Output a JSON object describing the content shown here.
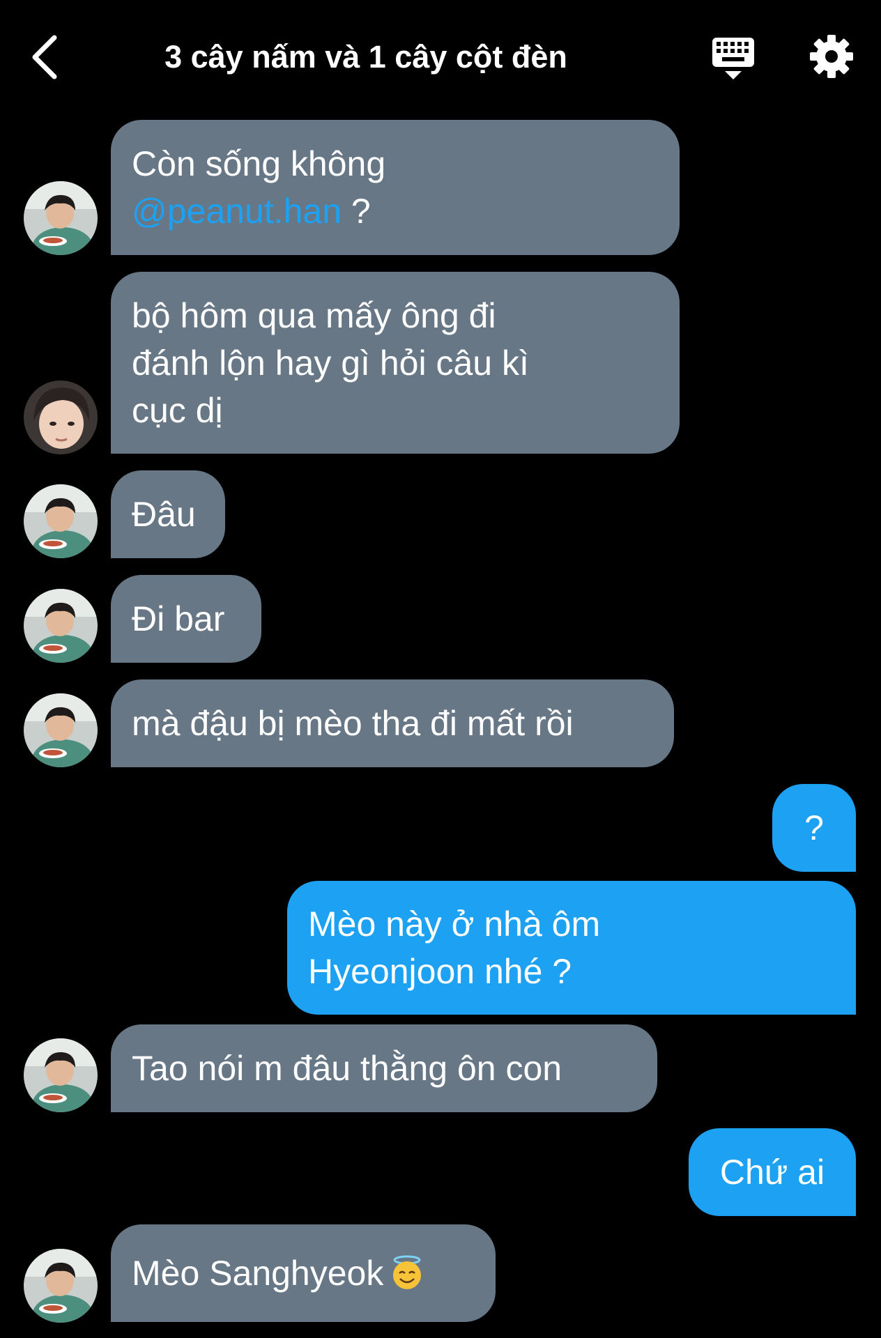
{
  "header": {
    "title": "3 cây nấm và 1 cây cột đèn"
  },
  "messages": [
    {
      "side": "in",
      "avatar": "person-eating",
      "lines": [
        "Còn sống không"
      ],
      "mention": "@peanut.han",
      "mention_suffix": " ?"
    },
    {
      "side": "in",
      "avatar": "person-selfie",
      "lines": [
        "bộ hôm qua mấy ông  đi",
        "đánh lộn hay gì hỏi câu kì",
        "cục dị"
      ]
    },
    {
      "side": "in",
      "avatar": "person-eating",
      "lines": [
        "Đâu"
      ]
    },
    {
      "side": "in",
      "avatar": "person-eating",
      "lines": [
        "Đi bar"
      ]
    },
    {
      "side": "in",
      "avatar": "person-eating",
      "lines": [
        "mà đậu bị mèo tha đi mất rồi"
      ]
    },
    {
      "side": "out",
      "lines": [
        "?"
      ]
    },
    {
      "side": "out",
      "lines": [
        "Mèo này ở nhà ôm",
        "Hyeonjoon nhé ?"
      ]
    },
    {
      "side": "in",
      "avatar": "person-eating",
      "lines": [
        "Tao nói m đâu thằng ôn con"
      ]
    },
    {
      "side": "out",
      "lines": [
        "Chứ ai"
      ]
    },
    {
      "side": "in",
      "avatar": "person-eating",
      "lines": [
        "Mèo Sanghyeok"
      ],
      "emoji": "smiling-face-with-halo"
    }
  ],
  "colors": {
    "incoming_bubble": "#677786",
    "outgoing_bubble": "#1da1f2",
    "mention": "#1da1f2",
    "background": "#000000"
  },
  "icons": {
    "back": "chevron-left-icon",
    "keyboard": "keyboard-icon",
    "settings": "gear-icon"
  }
}
